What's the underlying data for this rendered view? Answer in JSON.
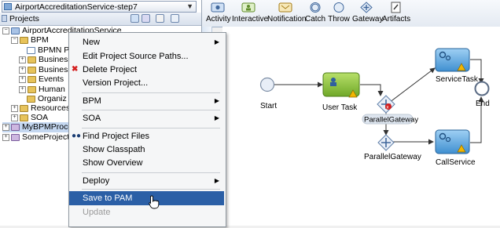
{
  "navigator": {
    "app_selector": "AirportAccreditationService-step7",
    "panel_title": "Projects",
    "tree": [
      {
        "label": "AirportAccreditationService",
        "icon": "project-icon"
      },
      {
        "label": "BPM",
        "icon": "folder-icon"
      },
      {
        "label": "BPMN Pr",
        "icon": "document-icon"
      },
      {
        "label": "Business",
        "icon": "folder-icon"
      },
      {
        "label": "Business",
        "icon": "folder-icon"
      },
      {
        "label": "Events",
        "icon": "folder-icon"
      },
      {
        "label": "Human",
        "icon": "folder-icon"
      },
      {
        "label": "Organiz",
        "icon": "folder-icon"
      },
      {
        "label": "Resources",
        "icon": "folder-icon"
      },
      {
        "label": "SOA",
        "icon": "folder-icon"
      },
      {
        "label": "MyBPMProcess",
        "icon": "group-icon"
      },
      {
        "label": "SomeProject [v",
        "icon": "group-icon"
      }
    ]
  },
  "context_menu": {
    "items": [
      {
        "label": "New",
        "submenu": true
      },
      {
        "label": "Edit Project Source Paths..."
      },
      {
        "label": "Delete Project",
        "icon": "delete-x-icon"
      },
      {
        "label": "Version Project..."
      },
      {
        "label": "BPM",
        "submenu": true
      },
      {
        "label": "SOA",
        "submenu": true
      },
      {
        "label": "Find Project Files",
        "icon": "binoculars-icon"
      },
      {
        "label": "Show Classpath"
      },
      {
        "label": "Show Overview"
      },
      {
        "label": "Deploy",
        "submenu": true
      },
      {
        "label": "Save to PAM",
        "highlighted": true
      },
      {
        "label": "Update",
        "disabled": true
      }
    ]
  },
  "palette": {
    "items": [
      {
        "label": "Activity",
        "icon": "activity-icon"
      },
      {
        "label": "Interactive",
        "icon": "interactive-icon"
      },
      {
        "label": "Notification",
        "icon": "notification-icon"
      },
      {
        "label": "Catch",
        "icon": "catch-icon"
      },
      {
        "label": "Throw",
        "icon": "throw-icon"
      },
      {
        "label": "Gateway",
        "icon": "gateway-icon"
      },
      {
        "label": "Artifacts",
        "icon": "artifacts-icon"
      }
    ]
  },
  "diagram": {
    "start": "Start",
    "user_task": "User Task",
    "parallel_gateway_1": "ParallelGateway",
    "parallel_gateway_2": "ParallelGateway",
    "service_task": "ServiceTask",
    "call_service": "CallService",
    "end": "End"
  },
  "colors": {
    "menu_highlight": "#2b5fa6",
    "user_task_fill": "#8cc43c",
    "service_fill": "#5aa7e0",
    "warning": "#f2b500",
    "error": "#d42020"
  }
}
